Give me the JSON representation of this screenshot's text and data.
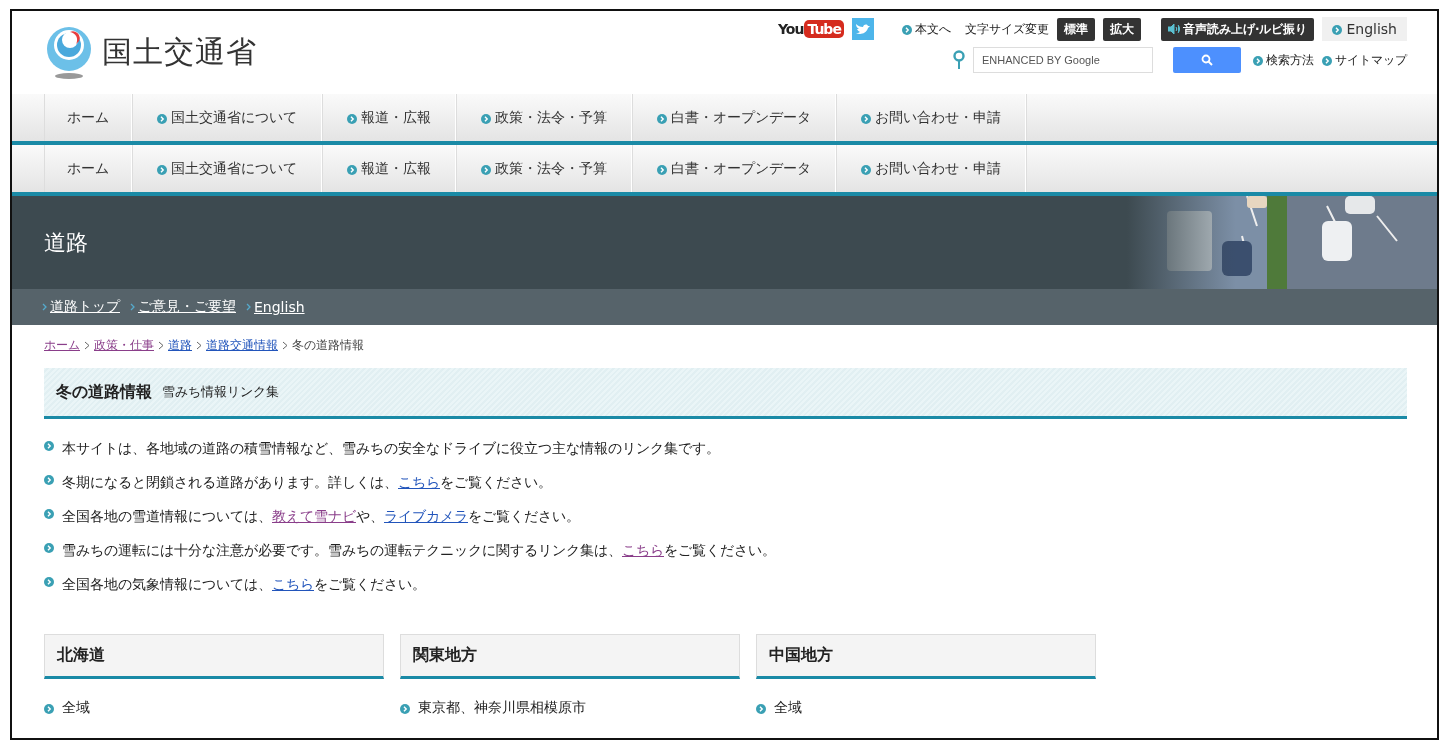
{
  "header": {
    "site_title": "国土交通省",
    "youtube": {
      "part_1": "You",
      "part_2": "Tube"
    },
    "utility_links": [
      {
        "label": "本文へ"
      }
    ],
    "font_size": {
      "label": "文字サイズ変更",
      "buttons": [
        {
          "label": "標準"
        },
        {
          "label": "拡大"
        }
      ]
    },
    "speech_button": {
      "label": "音声読み上げ·ルビ振り"
    },
    "english_button": {
      "label": "English"
    },
    "search": {
      "placeholder": "ENHANCED BY Google"
    },
    "search_links": [
      {
        "label": "検索方法"
      },
      {
        "label": "サイトマップ"
      }
    ]
  },
  "nav_bars": [
    {
      "items": [
        {
          "label": "ホーム",
          "kind": "plain"
        },
        {
          "label": "国土交通省について",
          "kind": "bullet"
        },
        {
          "label": "報道・広報",
          "kind": "bullet"
        },
        {
          "label": "政策・法令・予算",
          "kind": "bullet"
        },
        {
          "label": "白書・オープンデータ",
          "kind": "bullet"
        },
        {
          "label": "お問い合わせ・申請",
          "kind": "bullet"
        }
      ]
    },
    {
      "items": [
        {
          "label": "ホーム",
          "kind": "plain"
        },
        {
          "label": "国土交通省について",
          "kind": "bullet"
        },
        {
          "label": "報道・広報",
          "kind": "bullet"
        },
        {
          "label": "政策・法令・予算",
          "kind": "bullet"
        },
        {
          "label": "白書・オープンデータ",
          "kind": "bullet"
        },
        {
          "label": "お問い合わせ・申請",
          "kind": "bullet"
        }
      ]
    }
  ],
  "banner": {
    "title": "道路",
    "kind": "picture"
  },
  "sub_nav": [
    {
      "label": "道路トップ"
    },
    {
      "label": "ご意見・ご要望"
    },
    {
      "label": "English"
    }
  ],
  "breadcrumb": [
    {
      "label": "ホーム",
      "kind": "link",
      "visited": true
    },
    {
      "label": "政策・仕事",
      "kind": "link",
      "visited": true
    },
    {
      "label": "道路",
      "kind": "link",
      "visited": false
    },
    {
      "label": "道路交通情報",
      "kind": "link",
      "visited": false
    },
    {
      "label": "冬の道路情報",
      "kind": "current"
    }
  ],
  "page_heading": {
    "title": "冬の道路情報",
    "subtitle": "雪みち情報リンク集"
  },
  "notes": [
    {
      "parts": [
        {
          "text": "本サイトは、各地域の道路の積雪情報など、雪みちの安全なドライブに役立つ主な情報のリンク集です。"
        }
      ]
    },
    {
      "parts": [
        {
          "text": "冬期になると閉鎖される道路があります。詳しくは、"
        },
        {
          "text": "こちら",
          "kind": "link",
          "visited": false
        },
        {
          "text": "をご覧ください。"
        }
      ]
    },
    {
      "parts": [
        {
          "text": "全国各地の雪道情報については、"
        },
        {
          "text": "教えて雪ナビ",
          "kind": "link",
          "visited": true
        },
        {
          "text": "や、"
        },
        {
          "text": "ライブカメラ",
          "kind": "link",
          "visited": false
        },
        {
          "text": "をご覧ください。"
        }
      ]
    },
    {
      "parts": [
        {
          "text": "雪みちの運転には十分な注意が必要です。雪みちの運転テクニックに関するリンク集は、"
        },
        {
          "text": "こちら",
          "kind": "link",
          "visited": true
        },
        {
          "text": "をご覧ください。"
        }
      ]
    },
    {
      "parts": [
        {
          "text": "全国各地の気象情報については、"
        },
        {
          "text": "こちら",
          "kind": "link",
          "visited": false
        },
        {
          "text": "をご覧ください。"
        }
      ]
    }
  ],
  "regions": [
    {
      "title": "北海道",
      "items": [
        {
          "label": "全域"
        }
      ]
    },
    {
      "title": "関東地方",
      "items": [
        {
          "label": "東京都、神奈川県相模原市"
        }
      ]
    },
    {
      "title": "中国地方",
      "items": [
        {
          "label": "全域"
        }
      ]
    }
  ]
}
